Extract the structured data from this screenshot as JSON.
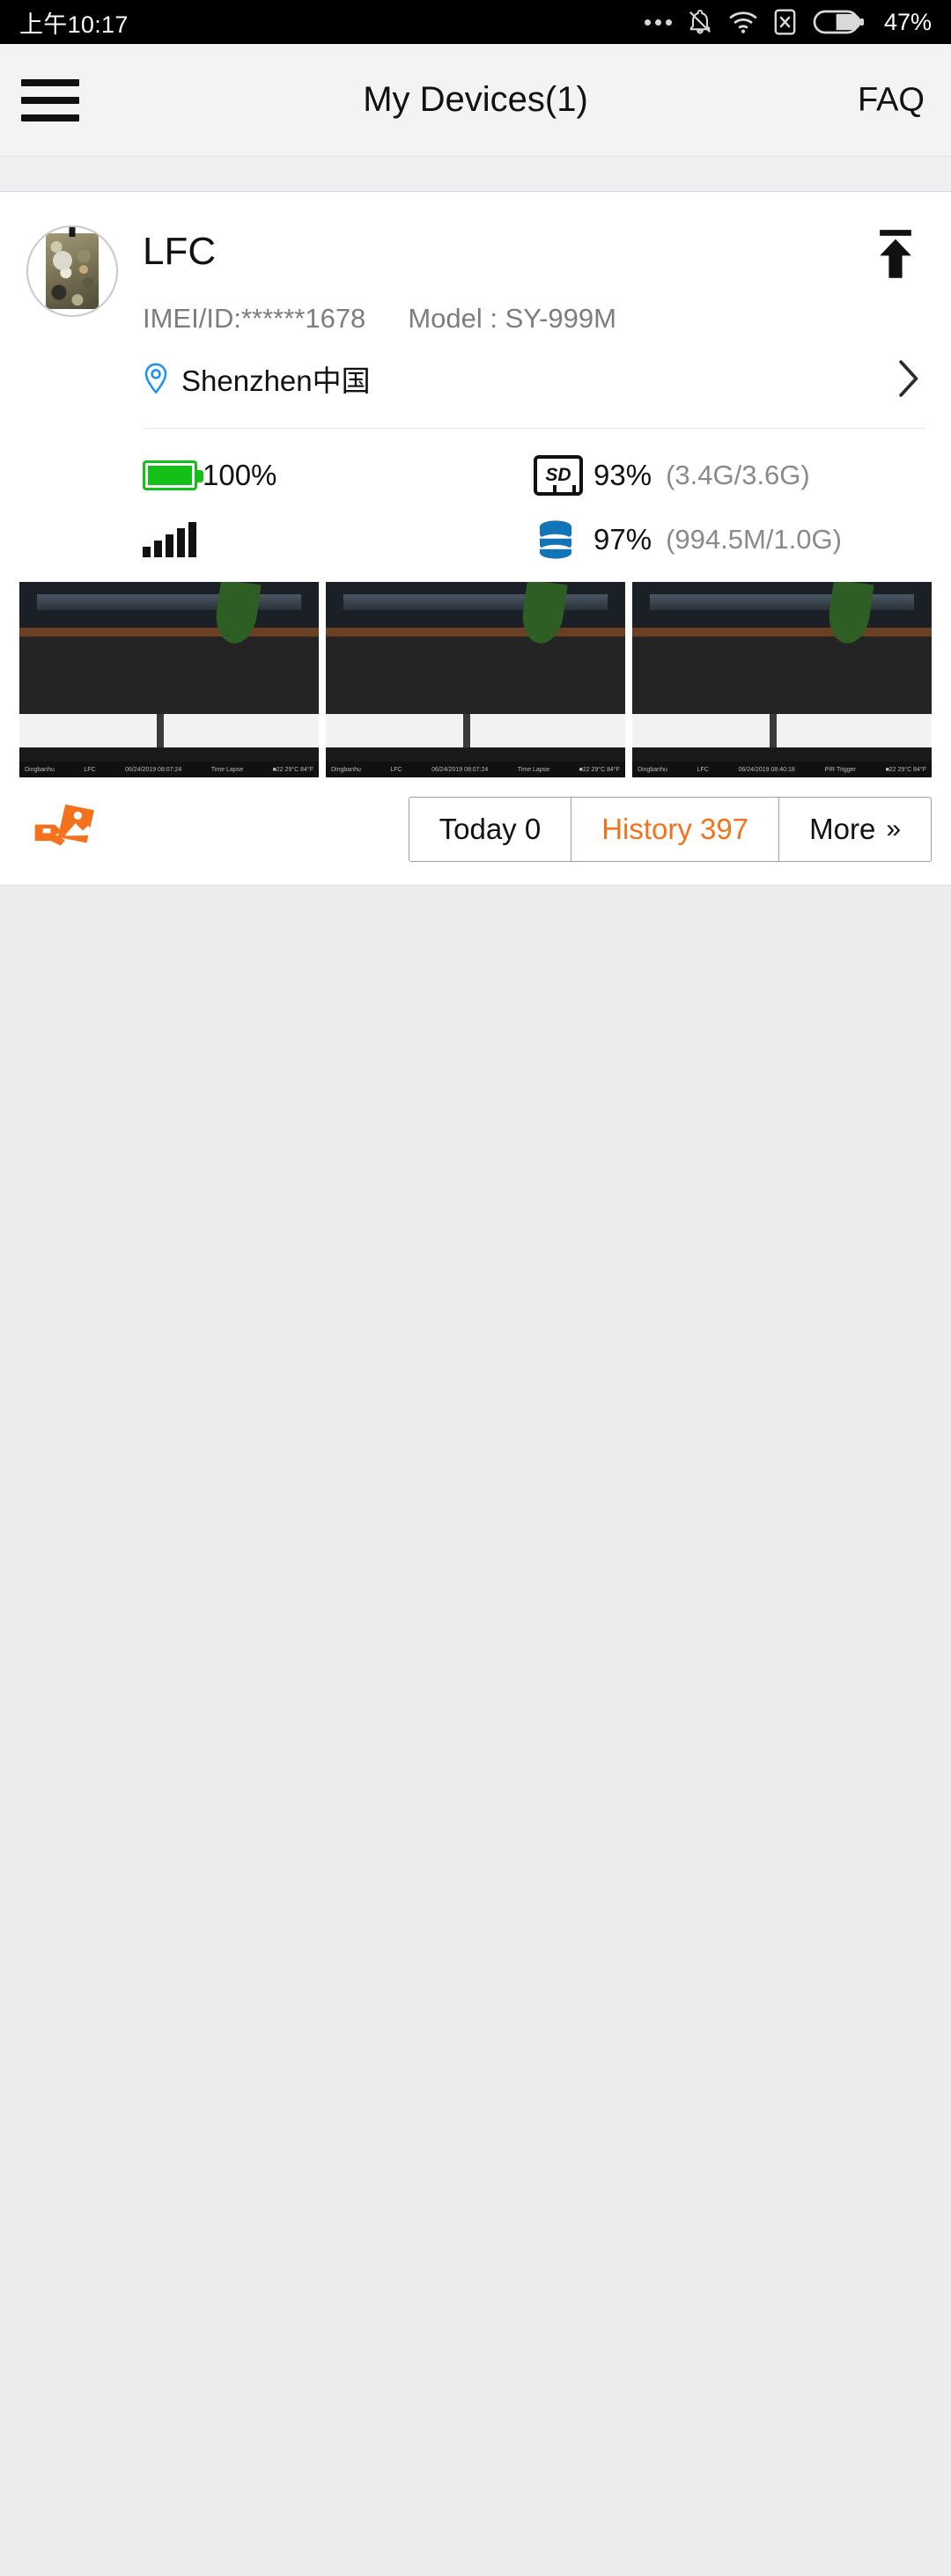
{
  "statusbar": {
    "time": "上午10:17",
    "battery_percent": "47%",
    "icons": [
      "more-dots-icon",
      "bell-muted-icon",
      "wifi-icon",
      "sim-card-off-icon",
      "battery-icon"
    ]
  },
  "appbar": {
    "menu_icon": "hamburger-menu-icon",
    "title": "My Devices(1)",
    "faq_label": "FAQ"
  },
  "device": {
    "avatar_icon": "trail-camera-avatar",
    "name": "LFC",
    "upload_icon": "upload-to-top-icon",
    "imei": "IMEI/ID:******1678",
    "model": "Model : SY-999M",
    "location_icon": "location-pin-icon",
    "location": "Shenzhen中国",
    "chevron_icon": "chevron-right-icon",
    "stats": [
      {
        "icon": "battery-full-icon",
        "value": "100%",
        "sub": ""
      },
      {
        "icon": "sd-card-icon",
        "value": "93%",
        "sub": "(3.4G/3.6G)"
      },
      {
        "icon": "signal-bars-icon",
        "value": "",
        "sub": ""
      },
      {
        "icon": "data-usage-icon",
        "value": "97%",
        "sub": "(994.5M/1.0G)"
      }
    ]
  },
  "thumbnails": [
    {
      "brand": "Dingbanhu",
      "device": "LFC",
      "datetime": "06/24/2019 08:07:24",
      "mode": "Time Lapse",
      "temp": "■22 29°C 84°F"
    },
    {
      "brand": "Dingbanhu",
      "device": "LFC",
      "datetime": "06/24/2019 08:07:24",
      "mode": "Time Lapse",
      "temp": "■22 29°C 84°F"
    },
    {
      "brand": "Dingbanhu",
      "device": "LFC",
      "datetime": "06/24/2019 08:40:18",
      "mode": "PIR Trigger",
      "temp": "■22 29°C 84°F"
    }
  ],
  "actions": {
    "gallery_icon": "photo-hand-icon",
    "buttons": [
      {
        "label": "Today 0",
        "accent": false,
        "chevrons": ""
      },
      {
        "label": "History 397",
        "accent": true,
        "chevrons": ""
      },
      {
        "label": "More",
        "accent": false,
        "chevrons": "»"
      }
    ]
  },
  "colors": {
    "accent_orange": "#f4721c",
    "battery_green": "#12c018",
    "pin_blue": "#1e90f5",
    "db_blue": "#1275b8"
  }
}
